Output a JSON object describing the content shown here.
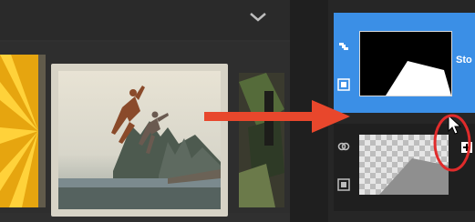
{
  "window": {
    "collapse_icon": "chevron-down-icon"
  },
  "filmstrip": {
    "items": [
      {
        "name": "yellow-rays-thumbnail"
      },
      {
        "name": "jumping-people-photo-thumbnail",
        "selected": true
      },
      {
        "name": "dark-photo-thumbnail"
      }
    ]
  },
  "annotation": {
    "arrow_color": "#e8472c",
    "highlight_color": "#e02b2b"
  },
  "layers": {
    "items": [
      {
        "name": "mask-layer",
        "label": "Sto",
        "selected": true,
        "icons": [
          "link-icon",
          "mask-icon"
        ]
      },
      {
        "name": "image-layer",
        "label": "",
        "selected": false,
        "icons": [
          "link-icon",
          "mask-icon"
        ]
      }
    ],
    "accent": "#3b8fe6"
  }
}
